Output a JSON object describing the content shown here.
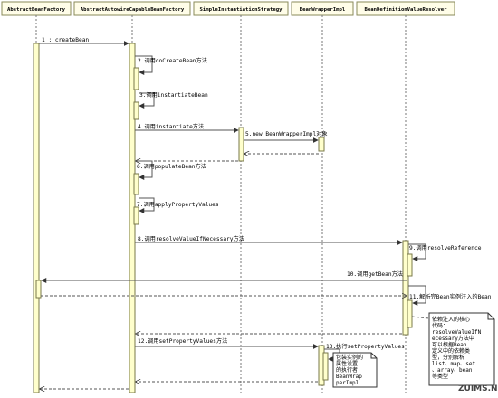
{
  "lifelines": [
    {
      "name": "AbstractBeanFactory"
    },
    {
      "name": "AbstractAutowireCapableBeanFactory"
    },
    {
      "name": "SimpleInstantiationStrategy"
    },
    {
      "name": "BeanWrapperImpl"
    },
    {
      "name": "BeanDefinitionValueResolver"
    }
  ],
  "messages": [
    {
      "label": "1 : createBean"
    },
    {
      "label": "2.调用doCreateBean方法"
    },
    {
      "label": "3.调用instantiateBean"
    },
    {
      "label": "4.调用instantiate方法"
    },
    {
      "label": "5.new BeanWrapperImpl对象"
    },
    {
      "label": "6.调用populateBean方法"
    },
    {
      "label": "7.调用applyPropertyValues"
    },
    {
      "label": "8.调用resolveValueIfNecessary方法"
    },
    {
      "label": "9.调用resolveReference"
    },
    {
      "label": "10.调用getBean方法"
    },
    {
      "label": "11.解析完Bean实例注入的Bean"
    },
    {
      "label": "12.调用setPropertyValues方法"
    },
    {
      "label": "13.执行setPropertyValues"
    }
  ],
  "notes": [
    {
      "lines": [
        "依赖注入的核心",
        "代码：",
        "resolveValueIfN",
        "ecessary方法中",
        "可以根据Bean",
        "定义中的依赖类",
        "型，分别解析",
        "list、map、set",
        "、array、bean",
        "等类型"
      ]
    },
    {
      "lines": [
        "包装实例的",
        "属性设置",
        "的执行者",
        "BeanWrap",
        "perImpl"
      ]
    }
  ],
  "watermark": "ZUIMS.NET"
}
